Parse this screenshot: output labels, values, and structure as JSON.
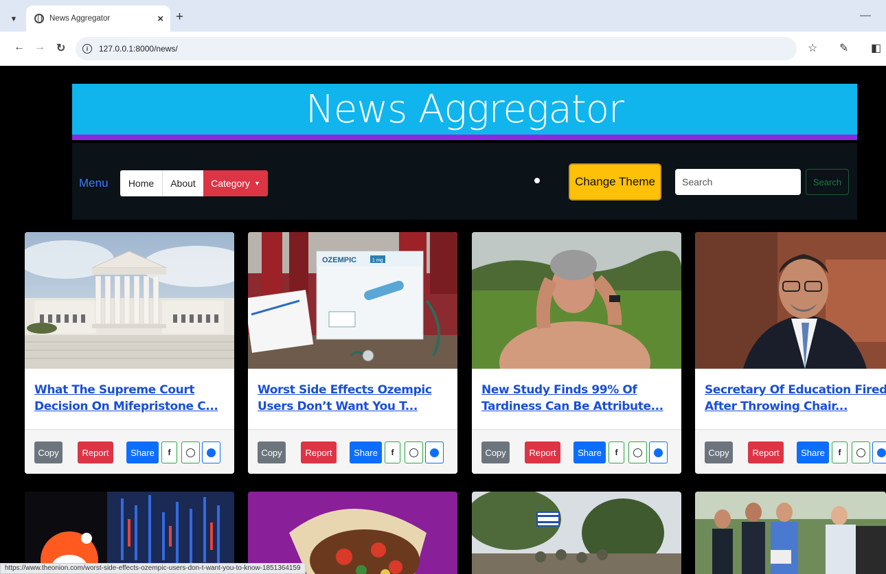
{
  "browser": {
    "tab_title": "News Aggregator",
    "tab_close": "×",
    "new_tab": "+",
    "url": "127.0.0.1:8000/news/",
    "status_url": "https://www.theonion.com/worst-side-effects-ozempic-users-don-t-want-you-to-know-1851364159"
  },
  "header": {
    "title": "News Aggregator"
  },
  "nav": {
    "menu_label": "Menu",
    "home": "Home",
    "about": "About",
    "category": "Category",
    "change_theme": "Change Theme",
    "search_placeholder": "Search",
    "search_button": "Search"
  },
  "card_actions": {
    "copy": "Copy",
    "report": "Report",
    "share": "Share",
    "facebook": "f"
  },
  "articles": [
    {
      "headline": "What The Supreme Court Decision On Mifepristone C..."
    },
    {
      "headline": "Worst Side Effects Ozempic Users Don’t Want You T..."
    },
    {
      "headline": "New Study Finds 99% Of Tardiness Can Be Attribute..."
    },
    {
      "headline": "Secretary Of Education Fired After Throwing Chair..."
    }
  ],
  "image_labels": {
    "ozempic_brand": "OZEMPIC",
    "ozempic_dose": "1 mg"
  },
  "colors": {
    "banner": "#10b5ee",
    "banner_border": "#8a2be2",
    "menu_text": "#3a7bff",
    "category": "#dc3545",
    "theme_button": "#ffc107",
    "link": "#1a4fd6"
  }
}
